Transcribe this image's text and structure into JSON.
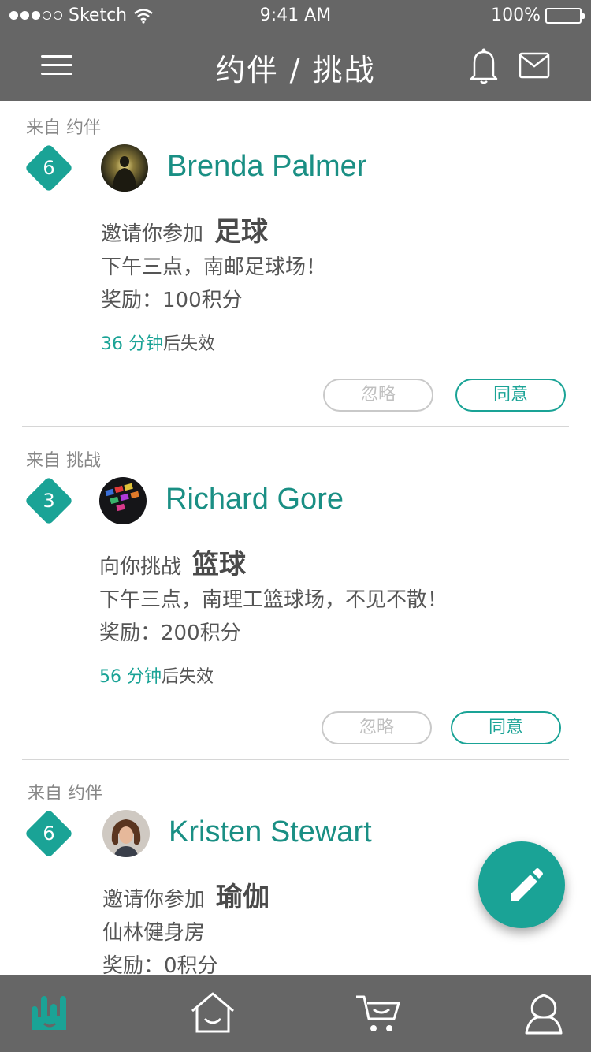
{
  "status_bar": {
    "carrier": "Sketch",
    "time": "9:41 AM",
    "battery": "100%"
  },
  "header": {
    "title": "约伴 / 挑战",
    "menu_icon": "menu-icon",
    "notification_icon": "bell-icon",
    "message_icon": "mail-icon"
  },
  "cards": [
    {
      "source": "来自 约伴",
      "count": "6",
      "name": "Brenda Palmer",
      "action": "邀请你参加",
      "sport": "足球",
      "detail": "下午三点，南邮足球场！",
      "reward": "奖励：100积分",
      "expire_mins": "36 分钟",
      "expire_suffix": "后失效",
      "ignore_label": "忽略",
      "agree_label": "同意"
    },
    {
      "source": "来自 挑战",
      "count": "3",
      "name": "Richard Gore",
      "action": "向你挑战",
      "sport": "篮球",
      "detail": "下午三点，南理工篮球场，不见不散！",
      "reward": "奖励：200积分",
      "expire_mins": "56 分钟",
      "expire_suffix": "后失效",
      "ignore_label": "忽略",
      "agree_label": "同意"
    },
    {
      "source": "来自 约伴",
      "count": "6",
      "name": "Kristen Stewart",
      "action": "邀请你参加",
      "sport": "瑜伽",
      "detail": "仙林健身房",
      "reward": "奖励：0积分"
    }
  ],
  "fab_icon": "pencil-icon",
  "tabbar": {
    "items": [
      "hand-icon",
      "home-icon",
      "cart-icon",
      "profile-icon"
    ],
    "active": "hand-icon"
  },
  "colors": {
    "accent": "#1aa396",
    "bar": "#666666"
  }
}
